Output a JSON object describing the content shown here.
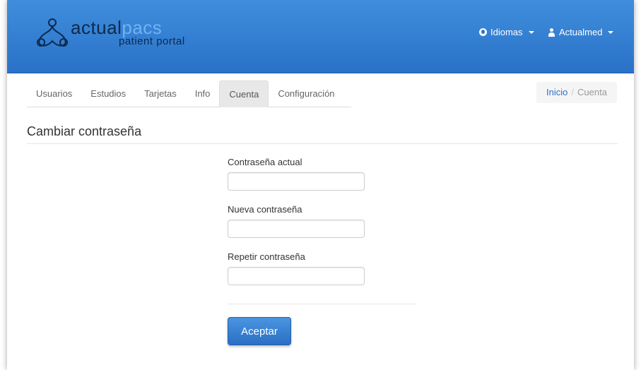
{
  "header": {
    "logo": {
      "word1": "actual",
      "word1_accent": "pacs",
      "word2": "patient portal"
    },
    "languages_label": "Idiomas",
    "user_label": "Actualmed"
  },
  "tabs": [
    {
      "label": "Usuarios",
      "active": false
    },
    {
      "label": "Estudios",
      "active": false
    },
    {
      "label": "Tarjetas",
      "active": false
    },
    {
      "label": "Info",
      "active": false
    },
    {
      "label": "Cuenta",
      "active": true
    },
    {
      "label": "Configuración",
      "active": false
    }
  ],
  "breadcrumb": {
    "home": "Inicio",
    "separator": "/",
    "current": "Cuenta"
  },
  "page": {
    "title": "Cambiar contraseña"
  },
  "form": {
    "current_password_label": "Contraseña actual",
    "new_password_label": "Nueva contraseña",
    "repeat_password_label": "Repetir contraseña",
    "submit_label": "Aceptar"
  },
  "colors": {
    "navbar": "#2a72c8",
    "accent": "#2a72c8"
  },
  "icons": {
    "languages": "globe-icon",
    "user": "user-icon",
    "dropdown": "caret-down-icon"
  }
}
